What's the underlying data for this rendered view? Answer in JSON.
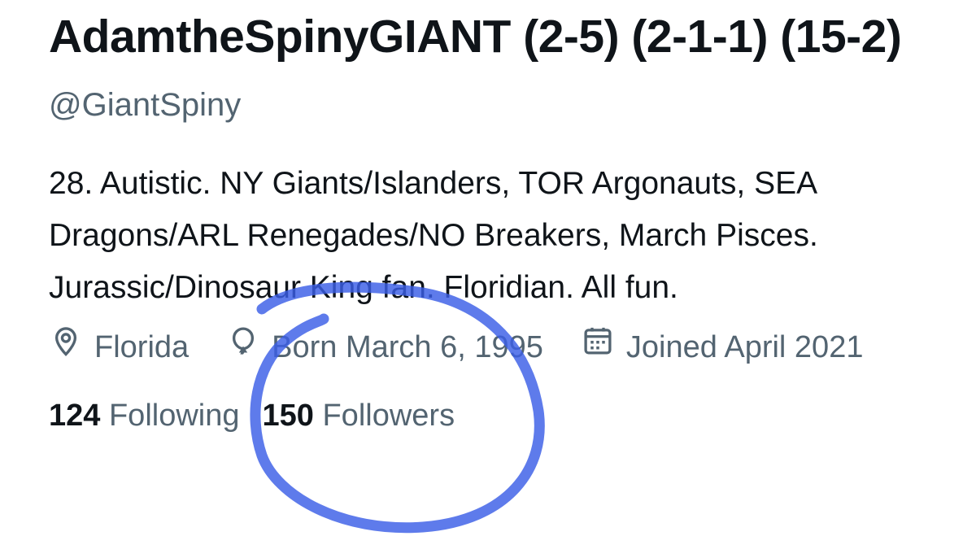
{
  "profile": {
    "display_name": "AdamtheSpinyGIANT (2-5) (2-1-1) (15-2)",
    "handle": "@GiantSpiny",
    "bio": "28. Autistic. NY Giants/Islanders, TOR Argonauts, SEA Dragons/ARL Renegades/NO Breakers, March Pisces. Jurassic/Dinosaur King fan. Floridian. All fun.",
    "location": "Florida",
    "birthday": "Born March 6, 1995",
    "joined": "Joined April 2021",
    "following_count": "124",
    "following_label": "Following",
    "followers_count": "150",
    "followers_label": "Followers"
  },
  "icons": {
    "location": "location-pin-icon",
    "birthday": "balloon-icon",
    "joined": "calendar-icon"
  },
  "colors": {
    "text_primary": "#0f1419",
    "text_secondary": "#536471",
    "annotation_stroke": "#3b5ee6"
  }
}
